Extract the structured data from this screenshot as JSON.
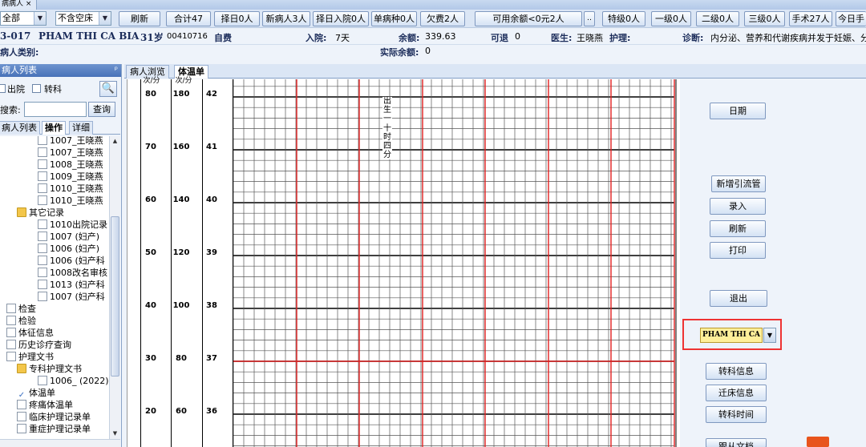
{
  "titlebar": {
    "tab_label": "病病人 ×"
  },
  "toolbar": {
    "filter_value": "全部",
    "bed_value": "不含空床",
    "buttons": [
      "刷新",
      "合计47",
      "择日0人",
      "新病人3人",
      "择日入院0人",
      "单病种0人",
      "欠费2人",
      "可用余额<0元2人",
      "特级0人",
      "一级0人",
      "二级0人",
      "三级0人",
      "手术27人",
      "今日手"
    ]
  },
  "patient": {
    "id": "3-017",
    "name": "PHAM THI CA BIA",
    "age": "31岁",
    "number": "00410716",
    "payment": "自费",
    "admit_label": "入院:",
    "admit_value": "7天",
    "balance_label": "余额:",
    "balance_value": "339.63",
    "refund_label": "可退",
    "refund_value": "0",
    "doctor_label": "医生:",
    "doctor_value": "王晓燕",
    "nursing_label": "护理:",
    "diagnosis_label": "诊断:",
    "diagnosis_value": "内分泌、营养和代谢疾病并发于妊娠、分",
    "category_label": "病人类别:",
    "actual_balance_label": "实际余额:",
    "actual_balance_value": "0"
  },
  "leftpanel": {
    "title": "病人列表",
    "pin": "ᵖ",
    "discharged_label": "出院",
    "transfer_label": "转科",
    "search_label": "搜索:",
    "query_button": "查询",
    "tabs": [
      "病人列表",
      "操作",
      "详细"
    ],
    "tree": [
      {
        "label": "1007_王晓燕",
        "indent": 3,
        "type": "doc"
      },
      {
        "label": "1007_王晓燕",
        "indent": 3,
        "type": "doc"
      },
      {
        "label": "1008_王晓燕",
        "indent": 3,
        "type": "doc"
      },
      {
        "label": "1009_王晓燕",
        "indent": 3,
        "type": "doc"
      },
      {
        "label": "1010_王晓燕",
        "indent": 3,
        "type": "doc"
      },
      {
        "label": "1010_王晓燕",
        "indent": 3,
        "type": "doc"
      },
      {
        "label": "其它记录",
        "indent": 1,
        "type": "folder"
      },
      {
        "label": "1010出院记录",
        "indent": 3,
        "type": "doc"
      },
      {
        "label": "1007 (妇产)",
        "indent": 3,
        "type": "doc"
      },
      {
        "label": "1006 (妇产)",
        "indent": 3,
        "type": "doc"
      },
      {
        "label": "1006 (妇产科",
        "indent": 3,
        "type": "doc"
      },
      {
        "label": "1008改名审核",
        "indent": 3,
        "type": "doc"
      },
      {
        "label": "1013 (妇产科",
        "indent": 3,
        "type": "doc"
      },
      {
        "label": "1007 (妇产科",
        "indent": 3,
        "type": "doc"
      },
      {
        "label": "检查",
        "indent": 0,
        "type": "doc"
      },
      {
        "label": "检验",
        "indent": 0,
        "type": "doc"
      },
      {
        "label": "体征信息",
        "indent": 0,
        "type": "doc"
      },
      {
        "label": "历史诊疗查询",
        "indent": 0,
        "type": "doc"
      },
      {
        "label": "护理文书",
        "indent": 0,
        "type": "doc"
      },
      {
        "label": "专科护理文书",
        "indent": 1,
        "type": "folder"
      },
      {
        "label": "1006_ (2022)",
        "indent": 3,
        "type": "doc"
      },
      {
        "label": "体温单",
        "indent": 1,
        "type": "check"
      },
      {
        "label": "疼痛体温单",
        "indent": 1,
        "type": "doc"
      },
      {
        "label": "临床护理记录单",
        "indent": 1,
        "type": "doc"
      },
      {
        "label": "重症护理记录单",
        "indent": 1,
        "type": "doc"
      }
    ]
  },
  "maintabs": [
    "病人浏览",
    "体温单"
  ],
  "scale": {
    "header_left": "次/分",
    "header_mid": "次/分",
    "rows": [
      {
        "c1": "80",
        "c2": "180",
        "c3": "42"
      },
      {
        "c1": "70",
        "c2": "160",
        "c3": "41"
      },
      {
        "c1": "60",
        "c2": "140",
        "c3": "40"
      },
      {
        "c1": "50",
        "c2": "120",
        "c3": "39"
      },
      {
        "c1": "40",
        "c2": "100",
        "c3": "38"
      },
      {
        "c1": "30",
        "c2": "80",
        "c3": "37"
      },
      {
        "c1": "20",
        "c2": "60",
        "c3": "36"
      }
    ]
  },
  "chart_annotation": "出生一十时四分",
  "rightpanel": {
    "buttons": [
      "日期",
      "新增引流管",
      "录入",
      "刷新",
      "打印",
      "退出"
    ],
    "patient_select": "PHAM THI CA",
    "lower_buttons": [
      "转科信息",
      "迁床信息",
      "转科时间",
      "跟从文档"
    ]
  }
}
